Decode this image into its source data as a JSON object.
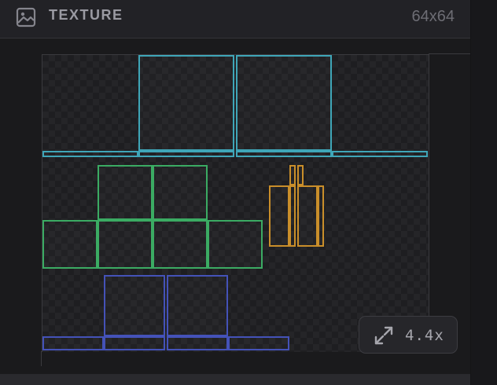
{
  "header": {
    "title": "TEXTURE",
    "size": "64x64",
    "icon": "image-icon"
  },
  "zoom": {
    "label": "4.4x",
    "icon": "expand-icon"
  },
  "colors": {
    "uv_head": "#3fa6b8",
    "uv_body": "#3bab63",
    "uv_arm": "#c98e2a",
    "uv_leg": "#4452b8"
  }
}
